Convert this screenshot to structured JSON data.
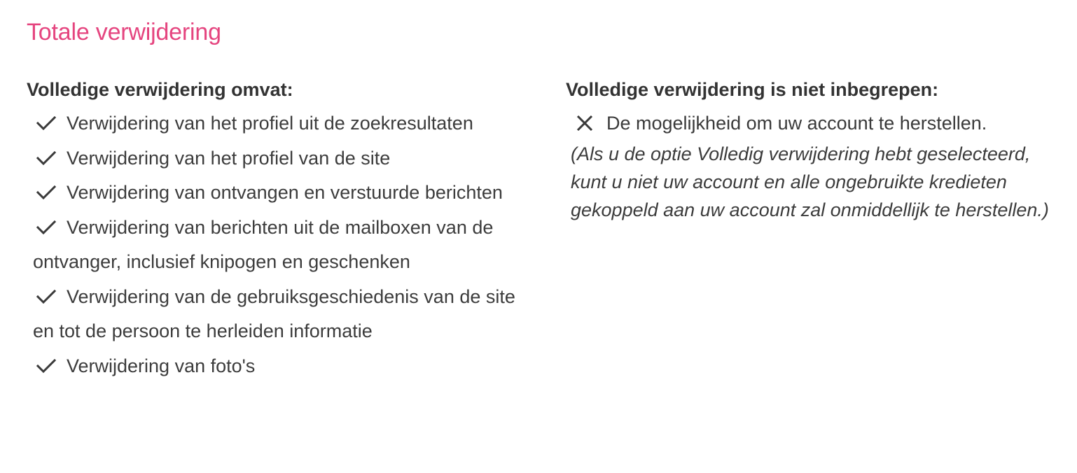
{
  "title": "Totale verwijdering",
  "accent_color": "#e5457f",
  "included": {
    "heading": "Volledige verwijdering omvat:",
    "icon": "check-icon",
    "items": [
      "Verwijdering van het profiel uit de zoekresultaten",
      "Verwijdering van het profiel van de site",
      "Verwijdering van ontvangen en verstuurde berichten",
      "Verwijdering van berichten uit de mailboxen van de ontvanger, inclusief knipogen en geschenken",
      "Verwijdering van de gebruiksgeschiedenis van de site en tot de persoon te herleiden informatie",
      "Verwijdering van foto's"
    ]
  },
  "excluded": {
    "heading": "Volledige verwijdering is niet inbegrepen:",
    "icon": "cross-icon",
    "items": [
      "De mogelijkheid om uw account te herstellen."
    ],
    "note": "(Als u de optie Volledig verwijdering hebt geselecteerd, kunt u niet uw account en alle ongebruikte kredieten gekoppeld aan uw account zal onmiddellijk te herstellen.)"
  }
}
